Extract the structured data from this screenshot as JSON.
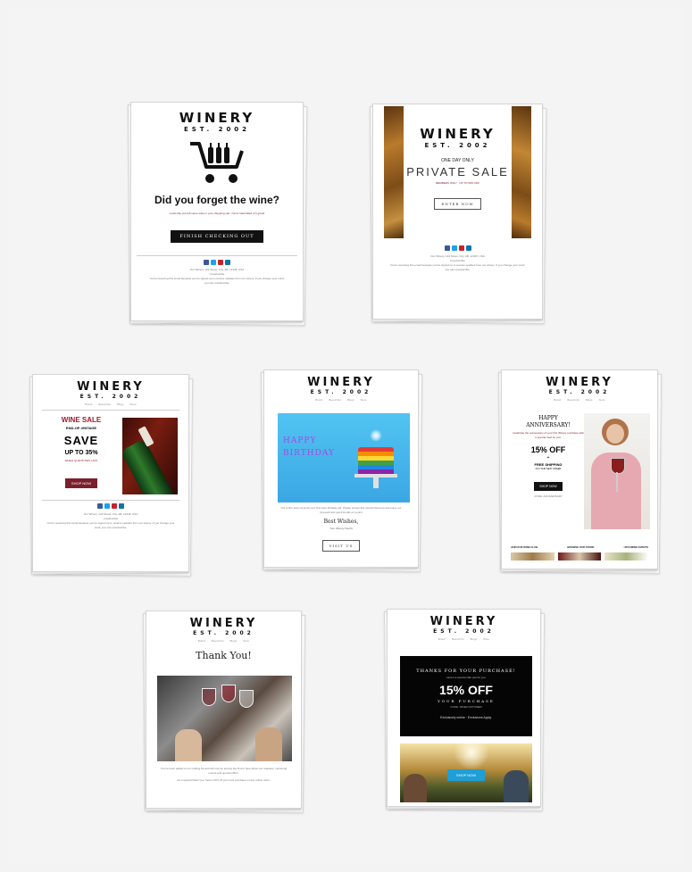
{
  "brand": {
    "name": "WINERY",
    "est": "EST. 2002"
  },
  "nav": [
    "Brand",
    "Beers/Info",
    "Blogs",
    "Store"
  ],
  "footer": {
    "address": "Our Winery, 123 Street, City, AB, 12345, USA",
    "unsubscribe": "Unsubscribe",
    "legal": "You're receiving this email because you've signed up to receive updates from our winery. If you change your mind, you can unsubscribe."
  },
  "colors": {
    "wine": "#7a1f2b",
    "black": "#111111",
    "teal": "#1e9fd6"
  },
  "emails": {
    "cart": {
      "headline": "Did you forget the wine?",
      "subtext": "Looks like you left some wine in your shopping cart. You're hard-billed of it great!",
      "button": "FINISH CHECKING OUT",
      "icon": "shopping-cart-with-bottles-icon"
    },
    "private": {
      "kicker": "ONE DAY ONLY",
      "headline": "PRIVATE SALE",
      "subtext": "MEMBERS ONLY · UP TO 50% OFF",
      "button": "ENTER NOW"
    },
    "wine_sale": {
      "title": "WINE SALE",
      "sub": "END-OF-VINTAGE",
      "save": "SAVE",
      "upto": "UP TO 35%",
      "note": "WHILE QUANTITIES LAST",
      "button": "SHOP NOW"
    },
    "birthday": {
      "line1": "HAPPY",
      "line2": "BIRTHDAY",
      "body": "Our entire team at (and) your first wine birthday gift. Please accept this special discount and enjoy our vineyard and good friends on yours!",
      "signoff": "Best Wishes,",
      "signature": "Your Winery Family",
      "button": "VISIT US"
    },
    "anniversary": {
      "line1": "HAPPY",
      "line2": "ANNIVERSARY!",
      "body": "Celebrate the anniversary of your first Winery purchase with a special treat for you.",
      "discount": "15% OFF",
      "plus": "+",
      "shipping": "FREE SHIPPING",
      "shipping_note": "ON YOUR NEXT ORDER",
      "button": "SHOP NOW",
      "code": "CODE: ANNIVERSARY",
      "links": [
        "JOIN OUR WINE CLUB",
        "BROWSE OUR STORE",
        "UPCOMING EVENTS"
      ]
    },
    "thanks": {
      "headline": "Thank You!",
      "body1": "You've been added to our mailing list and will now be among the first to hear about our releases, upcoming events and special offers.",
      "body2": "As a special thank you, here's 10% off your next purchase on any online order."
    },
    "purchase": {
      "headline": "THANKS FOR YOUR PURCHASE!",
      "sub": "Here's a special offer just for you",
      "discount": "15% OFF",
      "yours": "YOUR PURCHASE",
      "code": "CODE: WINECUSTOMER",
      "note": "Exclusively online · Exclusions Apply.",
      "button": "SHOP NOW"
    }
  }
}
